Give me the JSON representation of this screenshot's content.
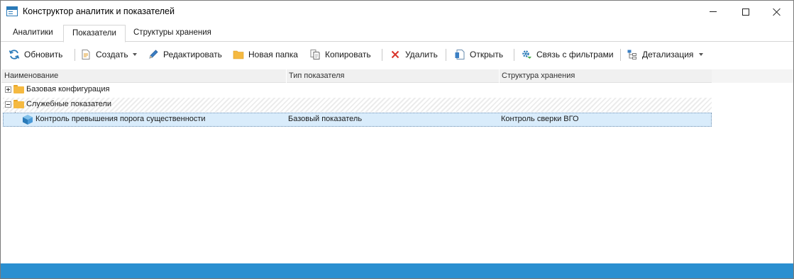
{
  "window": {
    "title": "Конструктор аналитик и показателей"
  },
  "tabs": [
    {
      "label": "Аналитики",
      "active": false
    },
    {
      "label": "Показатели",
      "active": true
    },
    {
      "label": "Структуры хранения",
      "active": false
    }
  ],
  "toolbar": {
    "refresh_label": "Обновить",
    "create_label": "Создать",
    "edit_label": "Редактировать",
    "new_folder_label": "Новая папка",
    "copy_label": "Копировать",
    "delete_label": "Удалить",
    "open_label": "Открыть",
    "filters_link_label": "Связь с фильтрами",
    "detail_label": "Детализация"
  },
  "grid": {
    "columns": [
      "Наименование",
      "Тип показателя",
      "Структура хранения"
    ],
    "rows": [
      {
        "name": "Базовая конфигурация",
        "type": "",
        "storage": "",
        "kind": "folder",
        "expanded": false
      },
      {
        "name": "Служебные показатели",
        "type": "",
        "storage": "",
        "kind": "folder",
        "expanded": true
      },
      {
        "name": "Контроль превышения порога существенности",
        "type": "Базовый показатель",
        "storage": "Контроль сверки ВГО",
        "kind": "indicator",
        "selected": true
      }
    ]
  },
  "colors": {
    "accent": "#2a8fd0",
    "selection": "#d9ecfb",
    "folder": "#f5b940",
    "delete": "#d9342b"
  },
  "icons": {
    "refresh": "refresh-icon",
    "create": "document-icon",
    "edit": "pencil-icon",
    "new_folder": "folder-icon",
    "copy": "copy-icon",
    "delete": "x-icon",
    "open": "open-document-icon",
    "filters": "gear-link-icon",
    "detail": "hierarchy-icon"
  }
}
